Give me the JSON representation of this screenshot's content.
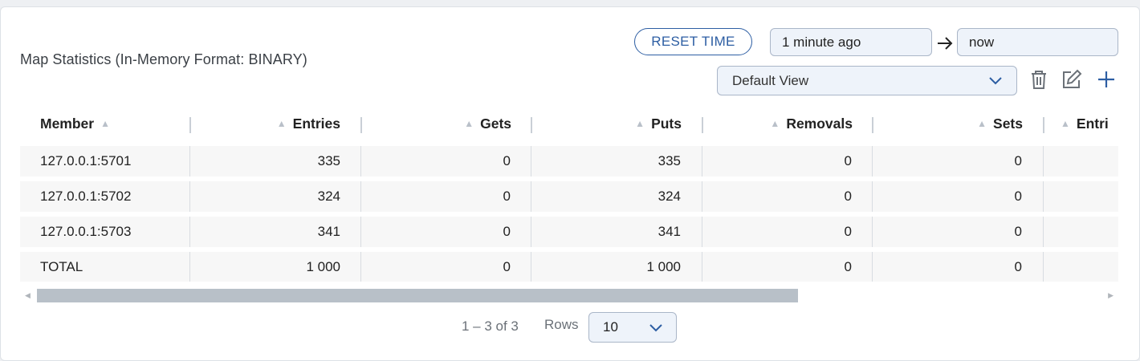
{
  "panel": {
    "title": "Map Statistics (In-Memory Format: BINARY)"
  },
  "time_controls": {
    "reset_label": "RESET TIME",
    "from_value": "1 minute ago",
    "to_value": "now"
  },
  "view": {
    "selected": "Default View",
    "icons": [
      "trash-icon",
      "edit-icon",
      "plus-icon"
    ]
  },
  "table": {
    "columns": [
      "Member",
      "Entries",
      "Gets",
      "Puts",
      "Removals",
      "Sets",
      "Entri"
    ],
    "rows": [
      {
        "member": "127.0.0.1:5701",
        "entries": "335",
        "gets": "0",
        "puts": "335",
        "removals": "0",
        "sets": "0"
      },
      {
        "member": "127.0.0.1:5702",
        "entries": "324",
        "gets": "0",
        "puts": "324",
        "removals": "0",
        "sets": "0"
      },
      {
        "member": "127.0.0.1:5703",
        "entries": "341",
        "gets": "0",
        "puts": "341",
        "removals": "0",
        "sets": "0"
      },
      {
        "member": "TOTAL",
        "entries": "1 000",
        "gets": "0",
        "puts": "1 000",
        "removals": "0",
        "sets": "0"
      }
    ]
  },
  "pagination": {
    "range_text": "1 – 3 of 3",
    "rows_label": "Rows",
    "rows_value": "10"
  },
  "colors": {
    "accent": "#2d5ea3",
    "row_bg": "#f7f7f7",
    "input_bg": "#eef3fa"
  }
}
